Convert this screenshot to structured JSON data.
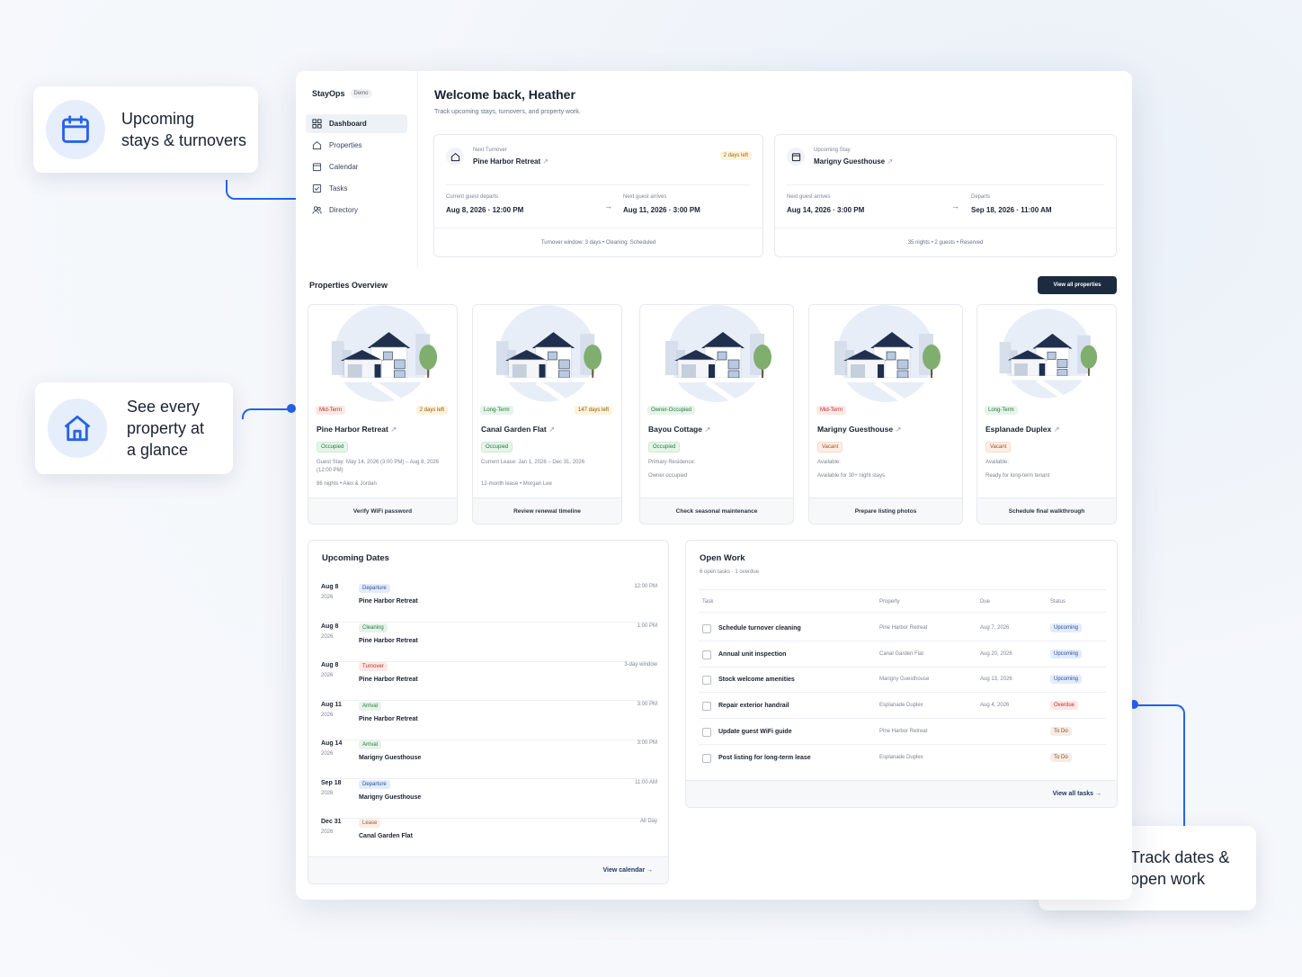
{
  "callouts": {
    "upcoming": {
      "line1": "Upcoming",
      "line2": "stays & turnovers"
    },
    "properties": {
      "line1": "See every",
      "line2": "property at",
      "line3": "a glance"
    },
    "track": {
      "line1": "Track dates &",
      "line2": "open work"
    }
  },
  "app": {
    "name": "StayOps",
    "badge": "Demo"
  },
  "sidebar": {
    "items": [
      {
        "label": "Dashboard",
        "icon": "grid-icon"
      },
      {
        "label": "Properties",
        "icon": "home-icon"
      },
      {
        "label": "Calendar",
        "icon": "calendar-icon"
      },
      {
        "label": "Tasks",
        "icon": "checklist-icon"
      },
      {
        "label": "Directory",
        "icon": "people-icon"
      }
    ]
  },
  "header": {
    "title": "Welcome back, Heather",
    "subtitle": "Track upcoming stays, turnovers, and property work."
  },
  "next_turnover": {
    "kicker": "Next Turnover",
    "property": "Pine Harbor Retreat",
    "pill": "2 days left",
    "left_label": "Current guest departs",
    "left_value": "Aug 8, 2026 · 12:00 PM",
    "right_label": "Next guest arrives",
    "right_value": "Aug 11, 2026 · 3:00 PM",
    "footer": "Turnover window: 3 days • Cleaning: Scheduled"
  },
  "upcoming_stay": {
    "kicker": "Upcoming Stay",
    "property": "Marigny Guesthouse",
    "left_label": "Next guest arrives",
    "left_value": "Aug 14, 2026 · 3:00 PM",
    "right_label": "Departs",
    "right_value": "Sep 18, 2026 · 11:00 AM",
    "footer": "35 nights • 2 guests • Reserved"
  },
  "properties_overview": {
    "title": "Properties Overview",
    "view_all": "View all properties",
    "cards": [
      {
        "type": "Mid-Term",
        "days": "2 days left",
        "name": "Pine Harbor Retreat",
        "status": "Occupied",
        "line1": "Guest Stay: May 14, 2026 (3:00 PM) – Aug 8, 2026 (12:00 PM)",
        "line2": "86 nights • Alex & Jordan",
        "action": "Verify WiFi password"
      },
      {
        "type": "Long-Term",
        "days": "147 days left",
        "name": "Canal Garden Flat",
        "status": "Occupied",
        "line1": "Current Lease: Jan 1, 2026 – Dec 31, 2026",
        "line2": "12-month lease • Morgan Lee",
        "action": "Review renewal timeline"
      },
      {
        "type": "Owner-Occupied",
        "days": "",
        "name": "Bayou Cottage",
        "status": "Occupied",
        "line1": "Primary Residence:",
        "line2": "Owner occupied",
        "action": "Check seasonal maintenance"
      },
      {
        "type": "Mid-Term",
        "days": "",
        "name": "Marigny Guesthouse",
        "status": "Vacant",
        "line1": "Available:",
        "line2": "Available for 30+ night stays",
        "action": "Prepare listing photos"
      },
      {
        "type": "Long-Term",
        "days": "",
        "name": "Esplanade Duplex",
        "status": "Vacant",
        "line1": "Available:",
        "line2": "Ready for long-term tenant",
        "action": "Schedule final walkthrough"
      }
    ]
  },
  "upcoming_dates": {
    "title": "Upcoming Dates",
    "rows": [
      {
        "date": "Aug 8",
        "year": "2026",
        "chip": "Departure",
        "property": "Pine Harbor Retreat",
        "time": "12:00 PM"
      },
      {
        "date": "Aug 8",
        "year": "2026",
        "chip": "Cleaning",
        "property": "Pine Harbor Retreat",
        "time": "1:00 PM"
      },
      {
        "date": "Aug 8",
        "year": "2026",
        "chip": "Turnover",
        "property": "Pine Harbor Retreat",
        "time": "3-day window"
      },
      {
        "date": "Aug 11",
        "year": "2026",
        "chip": "Arrival",
        "property": "Pine Harbor Retreat",
        "time": "3:00 PM"
      },
      {
        "date": "Aug 14",
        "year": "2026",
        "chip": "Arrival",
        "property": "Marigny Guesthouse",
        "time": "3:00 PM"
      },
      {
        "date": "Sep 18",
        "year": "2026",
        "chip": "Departure",
        "property": "Marigny Guesthouse",
        "time": "11:00 AM"
      },
      {
        "date": "Dec 31",
        "year": "2026",
        "chip": "Lease",
        "property": "Canal Garden Flat",
        "time": "All Day"
      }
    ],
    "footer": "View calendar →"
  },
  "open_work": {
    "title": "Open Work",
    "subtitle": "6 open tasks · 1 overdue",
    "columns": {
      "task": "Task",
      "property": "Property",
      "due": "Due",
      "status": "Status"
    },
    "rows": [
      {
        "task": "Schedule turnover cleaning",
        "property": "Pine Harbor Retreat",
        "due": "Aug 7, 2026",
        "status": "Upcoming"
      },
      {
        "task": "Annual unit inspection",
        "property": "Canal Garden Flat",
        "due": "Aug 20, 2026",
        "status": "Upcoming"
      },
      {
        "task": "Stock welcome amenities",
        "property": "Marigny Guesthouse",
        "due": "Aug 13, 2026",
        "status": "Upcoming"
      },
      {
        "task": "Repair exterior handrail",
        "property": "Esplanade Duplex",
        "due": "Aug 4, 2026",
        "status": "Overdue"
      },
      {
        "task": "Update guest WiFi guide",
        "property": "Pine Harbor Retreat",
        "due": "",
        "status": "To Do"
      },
      {
        "task": "Post listing for long-term lease",
        "property": "Esplanade Duplex",
        "due": "",
        "status": "To Do"
      }
    ],
    "footer": "View all tasks →"
  },
  "colors": {
    "accent": "#2563eb",
    "dark_button": "#1c2b3f",
    "navy_house": "#1f2f4d"
  }
}
